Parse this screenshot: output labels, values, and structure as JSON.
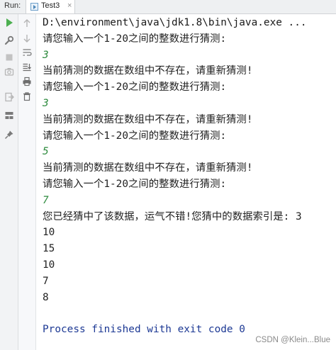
{
  "topbar": {
    "run_label": "Run:",
    "tab_label": "Test3",
    "tab_close": "×"
  },
  "toolbar_left": [
    {
      "name": "rerun-icon",
      "color": "#4caf50"
    },
    {
      "name": "wrench-icon",
      "color": "#8c8c8c"
    },
    {
      "name": "stop-icon",
      "color": "#b0b0b0"
    },
    {
      "name": "camera-icon",
      "color": "#b0b0b0"
    },
    {
      "name": "exit-icon",
      "color": "#b0b0b0"
    },
    {
      "name": "layout-icon",
      "color": "#6d6d6d"
    },
    {
      "name": "pin-icon",
      "color": "#6d6d6d"
    }
  ],
  "toolbar_right": [
    {
      "name": "arrow-up-icon"
    },
    {
      "name": "arrow-down-icon"
    },
    {
      "name": "soft-wrap-icon"
    },
    {
      "name": "scroll-to-end-icon"
    },
    {
      "name": "print-icon"
    },
    {
      "name": "trash-icon"
    }
  ],
  "console": {
    "lines": [
      {
        "text": "D:\\environment\\java\\jdk1.8\\bin\\java.exe ...",
        "kind": "path"
      },
      {
        "text": "请您输入一个1-20之间的整数进行猜测:",
        "kind": "out"
      },
      {
        "text": "3",
        "kind": "input"
      },
      {
        "text": "当前猜测的数据在数组中不存在，请重新猜测!",
        "kind": "out"
      },
      {
        "text": "请您输入一个1-20之间的整数进行猜测:",
        "kind": "out"
      },
      {
        "text": "3",
        "kind": "input"
      },
      {
        "text": "当前猜测的数据在数组中不存在，请重新猜测!",
        "kind": "out"
      },
      {
        "text": "请您输入一个1-20之间的整数进行猜测:",
        "kind": "out"
      },
      {
        "text": "5",
        "kind": "input"
      },
      {
        "text": "当前猜测的数据在数组中不存在，请重新猜测!",
        "kind": "out"
      },
      {
        "text": "请您输入一个1-20之间的整数进行猜测:",
        "kind": "out"
      },
      {
        "text": "7",
        "kind": "input"
      },
      {
        "text": "您已经猜中了该数据，运气不错!您猜中的数据索引是: 3",
        "kind": "out"
      },
      {
        "text": "10",
        "kind": "out"
      },
      {
        "text": "15",
        "kind": "out"
      },
      {
        "text": "10",
        "kind": "out"
      },
      {
        "text": "7",
        "kind": "out"
      },
      {
        "text": "8",
        "kind": "out"
      },
      {
        "text": "",
        "kind": "out"
      },
      {
        "text": "Process finished with exit code 0",
        "kind": "exit"
      }
    ]
  },
  "watermark": "CSDN @Klein...Blue"
}
